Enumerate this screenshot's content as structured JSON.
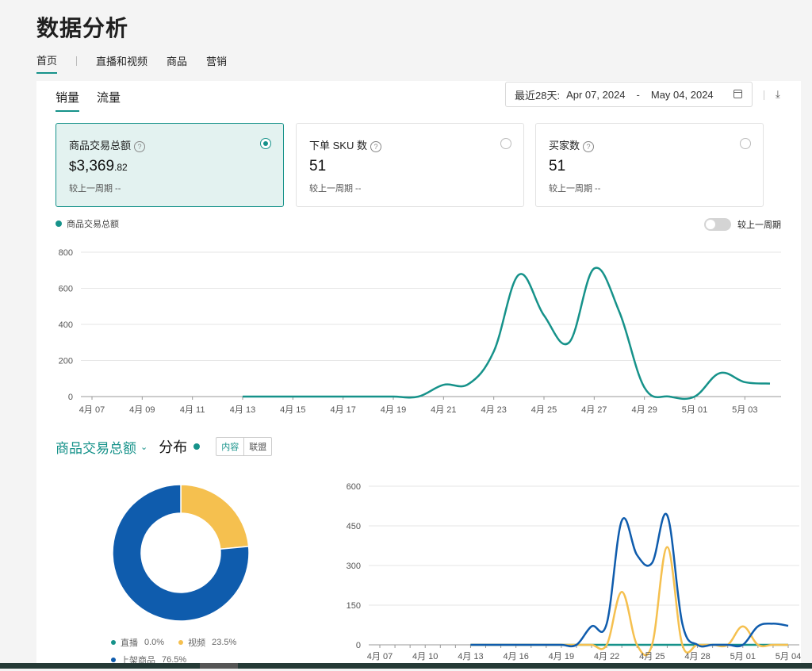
{
  "page_title": "数据分析",
  "nav_tabs": [
    "首页",
    "直播和视频",
    "商品",
    "营销"
  ],
  "sub_tabs": [
    "销量",
    "流量"
  ],
  "date_range": {
    "label": "最近28天:",
    "start": "Apr 07, 2024",
    "separator": "-",
    "end": "May 04, 2024"
  },
  "metrics": [
    {
      "label": "商品交易总额",
      "currency": "$",
      "value_int": "3,369",
      "value_dec": ".82",
      "compare": "较上一周期  --",
      "selected": true
    },
    {
      "label": "下单 SKU 数",
      "value_int": "51",
      "compare": "较上一周期  --",
      "selected": false
    },
    {
      "label": "买家数",
      "value_int": "51",
      "compare": "较上一周期  --",
      "selected": false
    }
  ],
  "trend_legend": "商品交易总额",
  "compare_toggle": {
    "label": "较上一周期",
    "on": false
  },
  "distribution": {
    "metric": "商品交易总额",
    "title": "分布",
    "segments": [
      "内容",
      "联盟"
    ],
    "legend": [
      {
        "name": "直播",
        "value": "0.0%",
        "color": "#16928a"
      },
      {
        "name": "视频",
        "value": "23.5%",
        "color": "#f5c04f"
      },
      {
        "name": "上架商品",
        "value": "76.5%",
        "color": "#0f5cad"
      }
    ]
  },
  "colors": {
    "accent": "#16928a",
    "video": "#f5c04f",
    "listing": "#0f5cad"
  },
  "chart_data": [
    {
      "type": "line",
      "x": [
        "4月 07",
        "4月 08",
        "4月 09",
        "4月 10",
        "4月 11",
        "4月 12",
        "4月 13",
        "4月 14",
        "4月 15",
        "4月 16",
        "4月 17",
        "4月 18",
        "4月 19",
        "4月 20",
        "4月 21",
        "4月 22",
        "4月 23",
        "4月 24",
        "4月 25",
        "4月 26",
        "4月 27",
        "4月 28",
        "4月 29",
        "4月 30",
        "5月 01",
        "5月 02",
        "5月 03",
        "5月 04"
      ],
      "tick_labels": [
        "4月 07",
        "4月 09",
        "4月 11",
        "4月 13",
        "4月 15",
        "4月 17",
        "4月 19",
        "4月 21",
        "4月 23",
        "4月 25",
        "4月 27",
        "4月 29",
        "5月 01",
        "5月 03"
      ],
      "series": [
        {
          "name": "商品交易总额",
          "color": "#16928a",
          "values": [
            null,
            null,
            null,
            null,
            null,
            null,
            0,
            0,
            0,
            0,
            0,
            0,
            0,
            0,
            65,
            70,
            250,
            675,
            450,
            300,
            710,
            470,
            50,
            0,
            0,
            130,
            80,
            72
          ]
        }
      ],
      "ylim": [
        0,
        800
      ],
      "yticks": [
        0,
        200,
        400,
        600,
        800
      ],
      "grid": true
    },
    {
      "type": "pie",
      "categories": [
        "直播",
        "视频",
        "上架商品"
      ],
      "values": [
        0.0,
        23.5,
        76.5
      ]
    },
    {
      "type": "line",
      "x": [
        "4月 07",
        "4月 08",
        "4月 09",
        "4月 10",
        "4月 11",
        "4月 12",
        "4月 13",
        "4月 14",
        "4月 15",
        "4月 16",
        "4月 17",
        "4月 18",
        "4月 19",
        "4月 20",
        "4月 21",
        "4月 22",
        "4月 23",
        "4月 24",
        "4月 25",
        "4月 26",
        "4月 27",
        "4月 28",
        "4月 29",
        "4月 30",
        "5月 01",
        "5月 02",
        "5月 03",
        "5月 04"
      ],
      "series": [
        {
          "name": "直播",
          "color": "#16928a",
          "values": [
            null,
            null,
            null,
            null,
            null,
            null,
            0,
            0,
            0,
            0,
            0,
            0,
            0,
            0,
            0,
            0,
            0,
            0,
            0,
            0,
            0,
            0,
            0,
            0,
            0,
            0,
            0,
            0
          ]
        },
        {
          "name": "视频",
          "color": "#f5c04f",
          "values": [
            null,
            null,
            null,
            null,
            null,
            null,
            0,
            0,
            0,
            0,
            0,
            0,
            0,
            0,
            0,
            0,
            200,
            0,
            0,
            370,
            0,
            0,
            0,
            0,
            70,
            0,
            0,
            0
          ]
        },
        {
          "name": "上架商品",
          "color": "#0f5cad",
          "values": [
            null,
            null,
            null,
            null,
            null,
            null,
            0,
            0,
            0,
            0,
            0,
            0,
            0,
            0,
            70,
            80,
            470,
            340,
            310,
            490,
            80,
            0,
            0,
            0,
            0,
            70,
            80,
            72
          ]
        }
      ],
      "ylim": [
        0,
        600
      ],
      "yticks": [
        0,
        150,
        300,
        450,
        600
      ],
      "grid": true
    }
  ]
}
